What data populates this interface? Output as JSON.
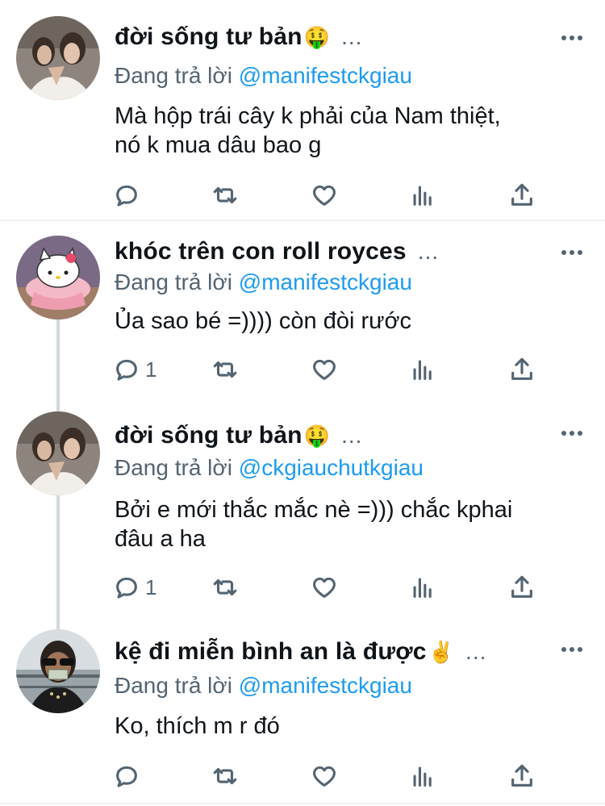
{
  "tweets": [
    {
      "name": "đời sống tư bản",
      "emoji": "🤑",
      "reply_prefix": "Đang trả lời",
      "reply_handle": "@manifestckgiau",
      "text_line1": "Mà hộp trái cây k phải của Nam thiệt,",
      "text_line2": "nó k mua dâu bao g",
      "reply_count": "",
      "avatar": "woman-portrait"
    },
    {
      "name": "khóc trên con roll royces",
      "emoji": "",
      "reply_prefix": "Đang trả lời",
      "reply_handle": "@manifestckgiau",
      "text_line1": "Ủa sao bé =)))) còn đòi rước",
      "text_line2": "",
      "reply_count": "1",
      "avatar": "hello-kitty"
    },
    {
      "name": "đời sống tư bản",
      "emoji": "🤑",
      "reply_prefix": "Đang trả lời",
      "reply_handle": "@ckgiauchutkgiau",
      "text_line1": "Bởi e mới thắc mắc nè =))) chắc kphai",
      "text_line2": "đâu a ha",
      "reply_count": "1",
      "avatar": "woman-portrait"
    },
    {
      "name": "kệ đi miễn bình an là được",
      "emoji": "✌️",
      "reply_prefix": "Đang trả lời",
      "reply_handle": "@manifestckgiau",
      "text_line1": "Ko, thích m r đó",
      "text_line2": "",
      "reply_count": "",
      "avatar": "man-sunglasses"
    }
  ],
  "icons": [
    "reply-icon",
    "retweet-icon",
    "like-icon",
    "analytics-icon",
    "share-icon",
    "more-icon"
  ],
  "colors": {
    "text": "#0f1419",
    "muted": "#536471",
    "link": "#1d9bf0",
    "divider": "#eff3f4"
  },
  "ellipsis": "..."
}
